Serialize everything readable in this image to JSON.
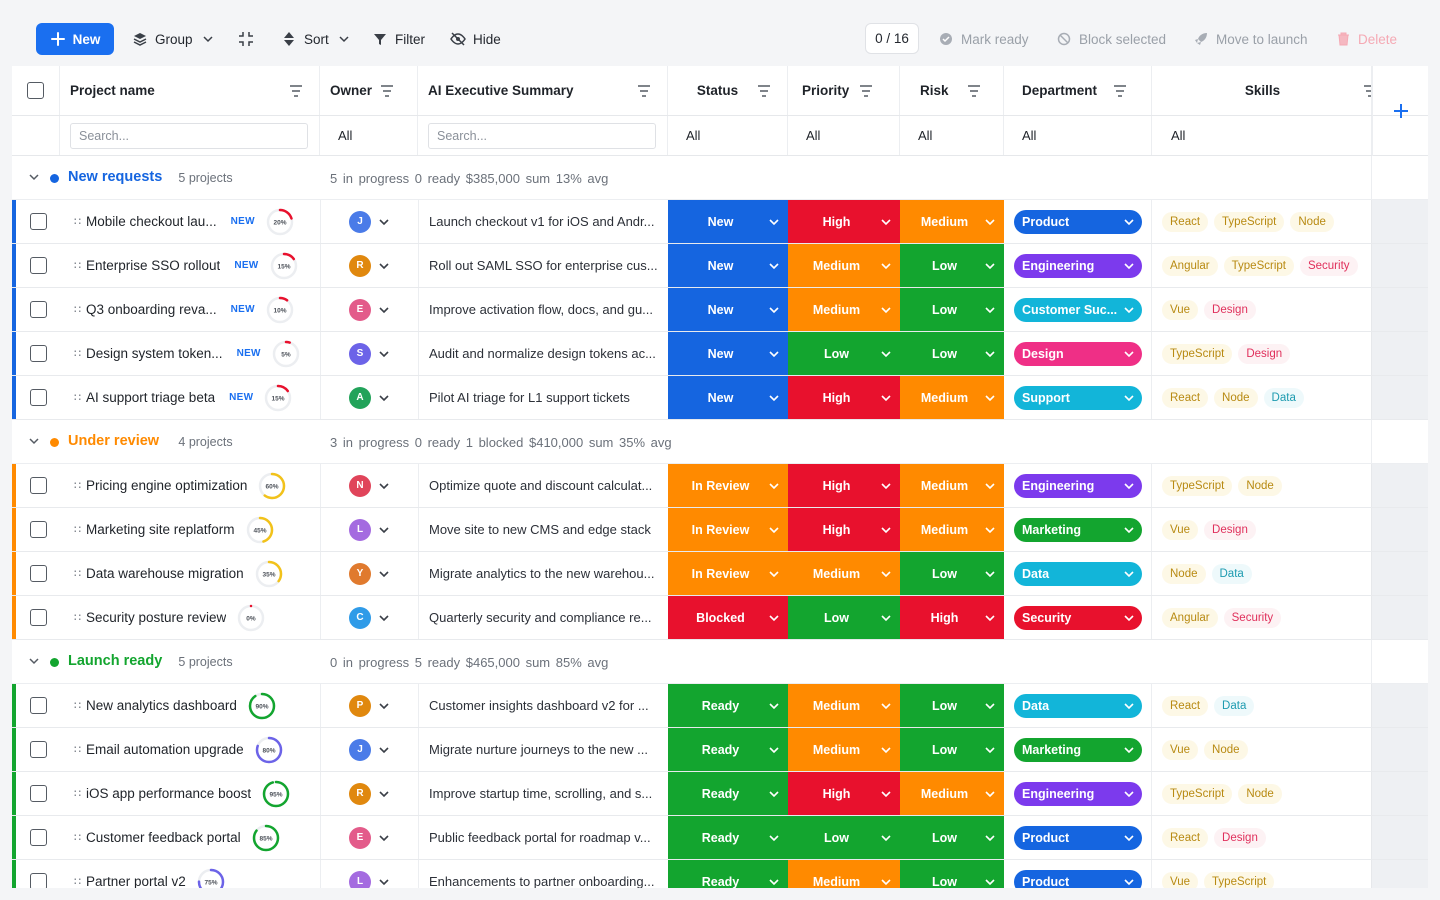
{
  "toolbar": {
    "new": "New",
    "group": "Group",
    "sort": "Sort",
    "filter": "Filter",
    "hide": "Hide",
    "selection": "0 / 16",
    "mark_ready": "Mark ready",
    "block_selected": "Block selected",
    "move_to_launch": "Move to launch",
    "delete": "Delete"
  },
  "columns": {
    "project": "Project name",
    "owner": "Owner",
    "summary": "AI Executive Summary",
    "status": "Status",
    "priority": "Priority",
    "risk": "Risk",
    "department": "Department",
    "skills": "Skills"
  },
  "filters": {
    "project_placeholder": "Search...",
    "owner": "All",
    "summary_placeholder": "Search...",
    "status": "All",
    "priority": "All",
    "risk": "All",
    "department": "All",
    "skills": "All"
  },
  "colors": {
    "accent": "#1a6ff0",
    "status_new": "#1565e0",
    "status_review": "#ff8a00",
    "status_blocked": "#e8112d",
    "status_ready": "#13a52f",
    "high": "#e8112d",
    "medium": "#ff8a00",
    "low": "#13a52f"
  },
  "groups": [
    {
      "name": "New requests",
      "count": "5 projects",
      "stats": "5 in progress   0 ready   $385,000 sum   13% avg",
      "color": "#1565e0",
      "rows": [
        {
          "name": "Mobile checkout lau...",
          "is_new": true,
          "new_label": "NEW",
          "progress": 20,
          "progress_label": "20%",
          "owner": "J",
          "owner_color": "#4a7be8",
          "summary": "Launch checkout v1 for iOS and Andr...",
          "status": "New",
          "priority": "High",
          "risk": "Medium",
          "department": "Product",
          "dept_color": "#1565e0",
          "skills": [
            "React",
            "TypeScript",
            "Node"
          ]
        },
        {
          "name": "Enterprise SSO rollout",
          "is_new": true,
          "new_label": "NEW",
          "progress": 15,
          "progress_label": "15%",
          "owner": "R",
          "owner_color": "#e0880e",
          "summary": "Roll out SAML SSO for enterprise cus...",
          "status": "New",
          "priority": "Medium",
          "risk": "Low",
          "department": "Engineering",
          "dept_color": "#7c3aed",
          "skills": [
            "Angular",
            "TypeScript",
            "Security"
          ]
        },
        {
          "name": "Q3 onboarding reva...",
          "is_new": true,
          "new_label": "NEW",
          "progress": 10,
          "progress_label": "10%",
          "owner": "E",
          "owner_color": "#e35b8a",
          "summary": "Improve activation flow, docs, and gu...",
          "status": "New",
          "priority": "Medium",
          "risk": "Low",
          "department": "Customer Suc...",
          "dept_color": "#12b5d9",
          "skills": [
            "Vue",
            "Design"
          ]
        },
        {
          "name": "Design system token...",
          "is_new": true,
          "new_label": "NEW",
          "progress": 5,
          "progress_label": "5%",
          "owner": "S",
          "owner_color": "#6c63e8",
          "summary": "Audit and normalize design tokens ac...",
          "status": "New",
          "priority": "Low",
          "risk": "Low",
          "department": "Design",
          "dept_color": "#ef2f86",
          "skills": [
            "TypeScript",
            "Design"
          ]
        },
        {
          "name": "AI support triage beta",
          "is_new": true,
          "new_label": "NEW",
          "progress": 15,
          "progress_label": "15%",
          "owner": "A",
          "owner_color": "#22a35a",
          "summary": "Pilot AI triage for L1 support tickets",
          "status": "New",
          "priority": "High",
          "risk": "Medium",
          "department": "Support",
          "dept_color": "#12b5d9",
          "skills": [
            "React",
            "Node",
            "Data"
          ]
        }
      ]
    },
    {
      "name": "Under review",
      "count": "4 projects",
      "stats": "3 in progress   0 ready   1 blocked   $410,000 sum   35% avg",
      "color": "#ff8a00",
      "rows": [
        {
          "name": "Pricing engine optimization",
          "is_new": false,
          "progress": 60,
          "progress_label": "60%",
          "owner": "N",
          "owner_color": "#e0445a",
          "summary": "Optimize quote and discount calculat...",
          "status": "In Review",
          "priority": "High",
          "risk": "Medium",
          "department": "Engineering",
          "dept_color": "#7c3aed",
          "skills": [
            "TypeScript",
            "Node"
          ]
        },
        {
          "name": "Marketing site replatform",
          "is_new": false,
          "progress": 45,
          "progress_label": "45%",
          "owner": "L",
          "owner_color": "#a46be0",
          "summary": "Move site to new CMS and edge stack",
          "status": "In Review",
          "priority": "High",
          "risk": "Medium",
          "department": "Marketing",
          "dept_color": "#13a52f",
          "skills": [
            "Vue",
            "Design"
          ]
        },
        {
          "name": "Data warehouse migration",
          "is_new": false,
          "progress": 35,
          "progress_label": "35%",
          "owner": "Y",
          "owner_color": "#e07a2e",
          "summary": "Migrate analytics to the new warehou...",
          "status": "In Review",
          "priority": "Medium",
          "risk": "Low",
          "department": "Data",
          "dept_color": "#12b5d9",
          "skills": [
            "Node",
            "Data"
          ]
        },
        {
          "name": "Security posture review",
          "is_new": false,
          "progress": 0,
          "progress_label": "0%",
          "owner": "C",
          "owner_color": "#2f9be8",
          "summary": "Quarterly security and compliance re...",
          "status": "Blocked",
          "priority": "Low",
          "risk": "High",
          "department": "Security",
          "dept_color": "#e8112d",
          "skills": [
            "Angular",
            "Security"
          ]
        }
      ]
    },
    {
      "name": "Launch ready",
      "count": "5 projects",
      "stats": "0 in progress   5 ready   $465,000 sum   85% avg",
      "color": "#13a52f",
      "rows": [
        {
          "name": "New analytics dashboard",
          "is_new": false,
          "progress": 90,
          "progress_label": "90%",
          "owner": "P",
          "owner_color": "#e0880e",
          "summary": "Customer insights dashboard v2 for ...",
          "status": "Ready",
          "priority": "Medium",
          "risk": "Low",
          "department": "Data",
          "dept_color": "#12b5d9",
          "skills": [
            "React",
            "Data"
          ]
        },
        {
          "name": "Email automation upgrade",
          "is_new": false,
          "progress": 80,
          "progress_label": "80%",
          "owner": "J",
          "owner_color": "#4a7be8",
          "summary": "Migrate nurture journeys to the new ...",
          "status": "Ready",
          "priority": "Medium",
          "risk": "Low",
          "department": "Marketing",
          "dept_color": "#13a52f",
          "skills": [
            "Vue",
            "Node"
          ]
        },
        {
          "name": "iOS app performance boost",
          "is_new": false,
          "progress": 95,
          "progress_label": "95%",
          "owner": "R",
          "owner_color": "#e0880e",
          "summary": "Improve startup time, scrolling, and s...",
          "status": "Ready",
          "priority": "High",
          "risk": "Medium",
          "department": "Engineering",
          "dept_color": "#7c3aed",
          "skills": [
            "TypeScript",
            "Node"
          ]
        },
        {
          "name": "Customer feedback portal",
          "is_new": false,
          "progress": 85,
          "progress_label": "85%",
          "owner": "E",
          "owner_color": "#e35b8a",
          "summary": "Public feedback portal for roadmap v...",
          "status": "Ready",
          "priority": "Low",
          "risk": "Low",
          "department": "Product",
          "dept_color": "#1565e0",
          "skills": [
            "React",
            "Design"
          ]
        },
        {
          "name": "Partner portal v2",
          "is_new": false,
          "progress": 75,
          "progress_label": "75%",
          "owner": "L",
          "owner_color": "#a46be0",
          "summary": "Enhancements to partner onboarding...",
          "status": "Ready",
          "priority": "Medium",
          "risk": "Low",
          "department": "Product",
          "dept_color": "#1565e0",
          "skills": [
            "Vue",
            "TypeScript"
          ]
        }
      ]
    }
  ]
}
